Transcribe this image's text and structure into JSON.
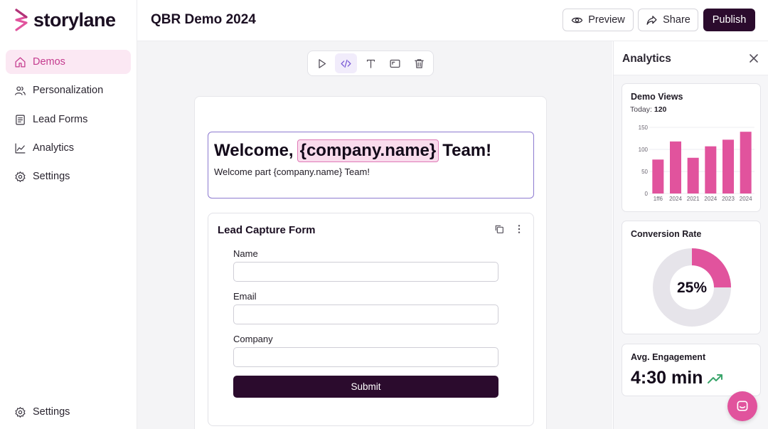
{
  "brand": {
    "name": "storylane",
    "accent": "#e1539d",
    "dark": "#2b0b2d"
  },
  "sidebar": {
    "items": [
      {
        "label": "Demos",
        "icon": "home-icon",
        "active": true
      },
      {
        "label": "Personalization",
        "icon": "users-icon"
      },
      {
        "label": "Lead Forms",
        "icon": "form-icon"
      },
      {
        "label": "Analytics",
        "icon": "chart-line-icon"
      },
      {
        "label": "Settings",
        "icon": "gear-icon"
      }
    ],
    "bottom": {
      "label": "Settings",
      "icon": "gear-icon"
    }
  },
  "header": {
    "title": "QBR Demo 2024",
    "preview_label": "Preview",
    "share_label": "Share",
    "publish_label": "Publish"
  },
  "editor": {
    "toolbar": [
      "play-icon",
      "code-icon",
      "text-icon",
      "frame-icon",
      "trash-icon"
    ],
    "headline": {
      "prefix": "Welcome,",
      "variable": "{company.name}",
      "suffix": "Team!"
    },
    "subline": "Welcome part {company.name} Team!",
    "form": {
      "title": "Lead Capture Form",
      "fields": [
        {
          "label": "Name",
          "value": ""
        },
        {
          "label": "Email",
          "value": ""
        },
        {
          "label": "Company",
          "value": ""
        }
      ],
      "submit_label": "Submit"
    }
  },
  "analytics": {
    "title": "Analytics",
    "demo_views": {
      "title": "Demo Views",
      "today_label": "Today:",
      "today_value": "120"
    },
    "conversion": {
      "title": "Conversion Rate",
      "value_label": "25%",
      "fraction": 0.25
    },
    "engagement": {
      "title": "Avg. Engagement",
      "value": "4:30 min"
    }
  },
  "chart_data": {
    "type": "bar",
    "categories": [
      "1ff6",
      "2024",
      "2021",
      "2024",
      "2023",
      "2024"
    ],
    "values": [
      77,
      118,
      81,
      107,
      122,
      140
    ],
    "ylim": [
      0,
      150
    ],
    "yticks": [
      0,
      50,
      100,
      150
    ],
    "grid": true,
    "color": "#e1539d"
  }
}
